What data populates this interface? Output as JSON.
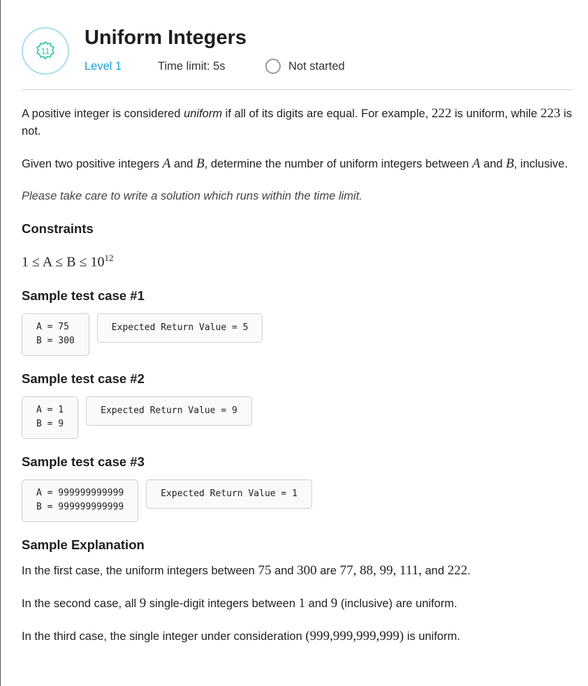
{
  "header": {
    "badge_number": "11",
    "title": "Uniform Integers",
    "level": "Level 1",
    "time_limit": "Time limit: 5s",
    "status": "Not started"
  },
  "statement": {
    "p1_a": "A positive integer is considered ",
    "p1_em": "uniform",
    "p1_b": " if all of its digits are equal. For example, ",
    "p1_n1": "222",
    "p1_c": " is uniform, while ",
    "p1_n2": "223",
    "p1_d": " is not.",
    "p2_a": "Given two positive integers ",
    "p2_A": "A",
    "p2_b": " and ",
    "p2_B": "B",
    "p2_c": ", determine the number of uniform integers between ",
    "p2_A2": "A",
    "p2_d": " and ",
    "p2_B2": "B",
    "p2_e": ", inclusive.",
    "note": "Please take care to write a solution which runs within the time limit."
  },
  "constraints": {
    "heading": "Constraints",
    "expr": "1 ≤ A ≤ B ≤ 10",
    "exp": "12"
  },
  "samples": [
    {
      "heading": "Sample test case #1",
      "input_a": "A = 75",
      "input_b": "B = 300",
      "result": "Expected Return Value = 5"
    },
    {
      "heading": "Sample test case #2",
      "input_a": "A = 1",
      "input_b": "B = 9",
      "result": "Expected Return Value = 9"
    },
    {
      "heading": "Sample test case #3",
      "input_a": "A = 999999999999",
      "input_b": "B = 999999999999",
      "result": "Expected Return Value = 1"
    }
  ],
  "explanation": {
    "heading": "Sample Explanation",
    "e1_a": "In the first case, the uniform integers between ",
    "e1_n1": "75",
    "e1_b": " and ",
    "e1_n2": "300",
    "e1_c": " are ",
    "e1_list": "77, 88, 99, 111,",
    "e1_d": " and ",
    "e1_n3": "222",
    "e1_e": ".",
    "e2_a": "In the second case, all ",
    "e2_n1": "9",
    "e2_b": " single-digit integers between ",
    "e2_n2": "1",
    "e2_c": " and ",
    "e2_n3": "9",
    "e2_d": " (inclusive) are uniform.",
    "e3_a": "In the third case, the single integer under consideration ",
    "e3_n": "(999,999,999,999)",
    "e3_b": " is uniform."
  },
  "colors": {
    "accent": "#1a9fd6",
    "badge_ring": "#a9dff0",
    "badge_icon": "#2ec4a0"
  },
  "icons": {
    "badge": "gear-badge-icon",
    "status": "empty-circle-icon"
  }
}
